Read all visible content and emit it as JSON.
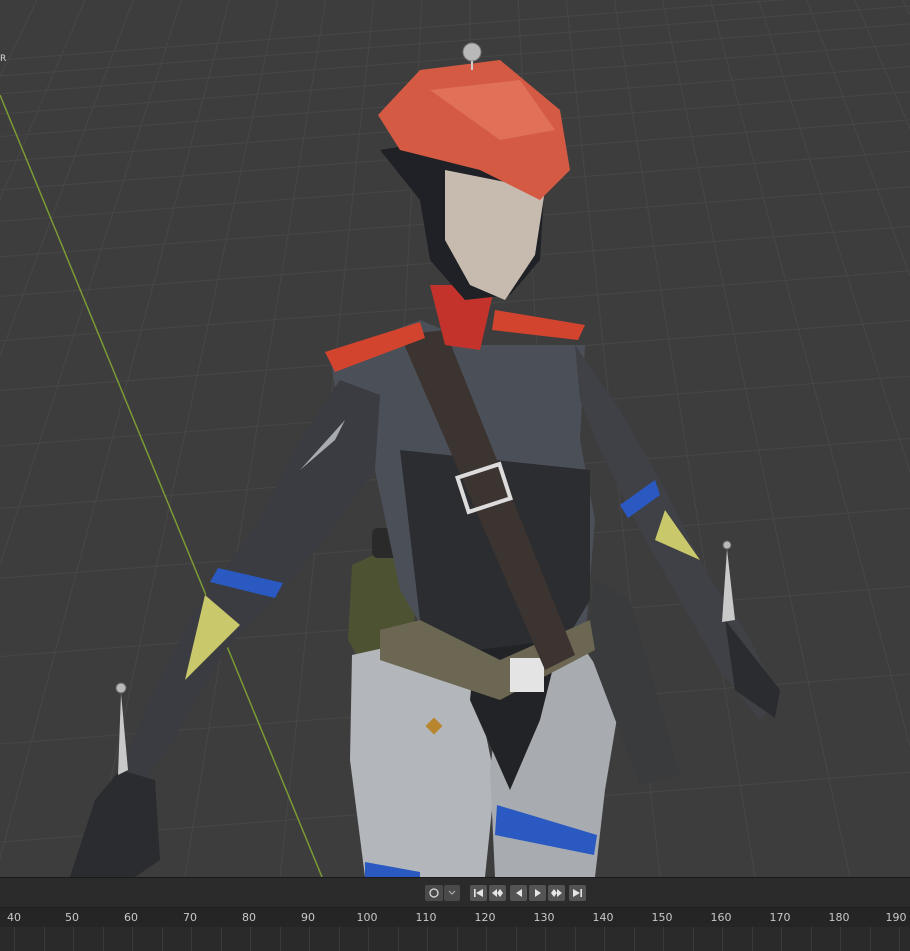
{
  "viewport": {
    "corner_label": "R",
    "colors": {
      "background": "#3d3d3d",
      "grid_line": "#474747",
      "axis_y": "#7a9b35",
      "beret": "#d45a44",
      "jacket": "#4b5058",
      "pants": "#b3b6ba",
      "strap_blue": "#2a59c2",
      "accent_yellow": "#c9c86a"
    }
  },
  "timeline": {
    "playback_controls": [
      {
        "name": "jump-to-start",
        "icon": "jump-start-icon"
      },
      {
        "name": "jump-to-prev-keyframe",
        "icon": "prev-keyframe-icon"
      },
      {
        "name": "play-reverse",
        "icon": "play-reverse-icon"
      },
      {
        "name": "play",
        "icon": "play-icon"
      },
      {
        "name": "jump-to-next-keyframe",
        "icon": "next-keyframe-icon"
      },
      {
        "name": "jump-to-end",
        "icon": "jump-end-icon"
      }
    ],
    "frame_labels": [
      "40",
      "50",
      "60",
      "70",
      "80",
      "90",
      "100",
      "110",
      "120",
      "130",
      "140",
      "150",
      "160",
      "170",
      "180",
      "190"
    ]
  }
}
